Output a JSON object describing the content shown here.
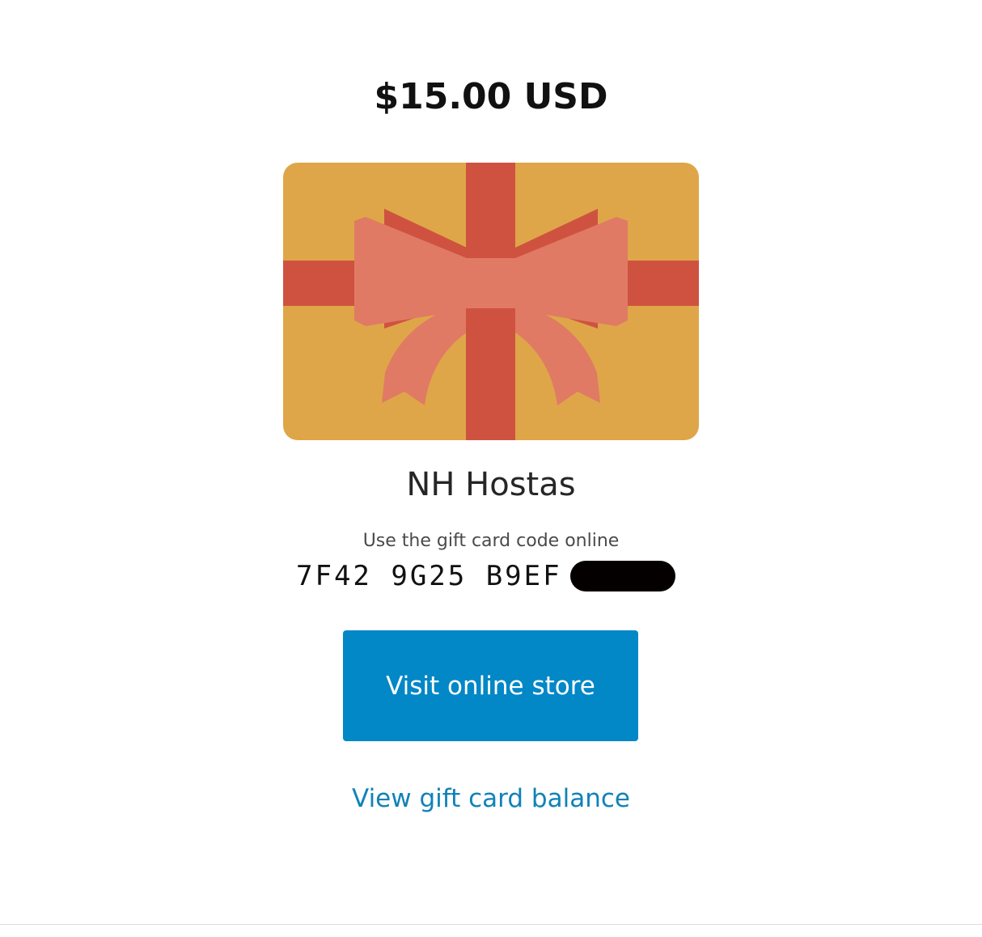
{
  "gift_card": {
    "amount": "$15.00 USD",
    "merchant_name": "NH Hostas",
    "code_label": "Use the gift card code online",
    "code_visible": "7F42 9G25 B9EF",
    "code_redacted": true
  },
  "actions": {
    "visit_store_label": "Visit online store",
    "view_balance_label": "View gift card balance"
  },
  "colors": {
    "card_background": "#dea648",
    "ribbon": "#cf5240",
    "bow": "#e07a64",
    "button": "#0287c7",
    "link": "#1182b8"
  },
  "icons": {
    "card_image": "gift-card-illustration"
  }
}
